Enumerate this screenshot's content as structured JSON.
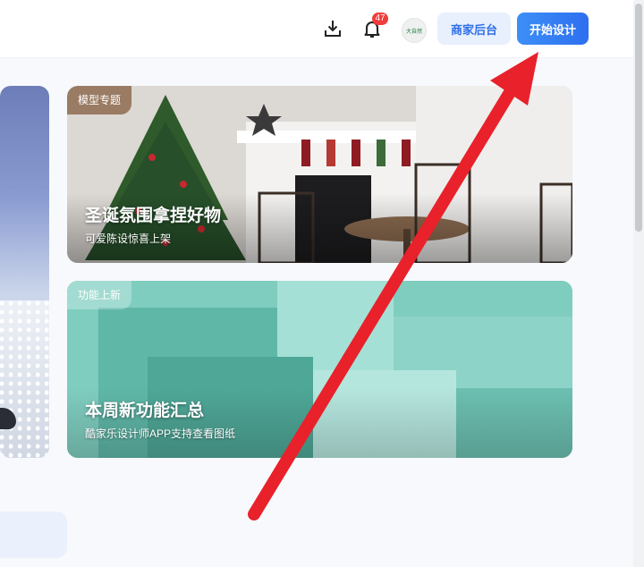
{
  "header": {
    "notification_count": "47",
    "avatar_text": "大自然",
    "merchant_label": "商家后台",
    "start_label": "开始设计"
  },
  "cards": {
    "xmas": {
      "tag": "模型专题",
      "title": "圣诞氛围拿捏好物",
      "subtitle": "可爱陈设惊喜上架"
    },
    "feature": {
      "tag": "功能上新",
      "title": "本周新功能汇总",
      "subtitle": "酷家乐设计师APP支持查看图纸"
    }
  },
  "colors": {
    "accent": "#2d6ff0",
    "arrow": "#e8212b",
    "badge": "#f23c3c"
  },
  "icons": [
    "download-icon",
    "bell-icon",
    "arrow-annotation"
  ]
}
